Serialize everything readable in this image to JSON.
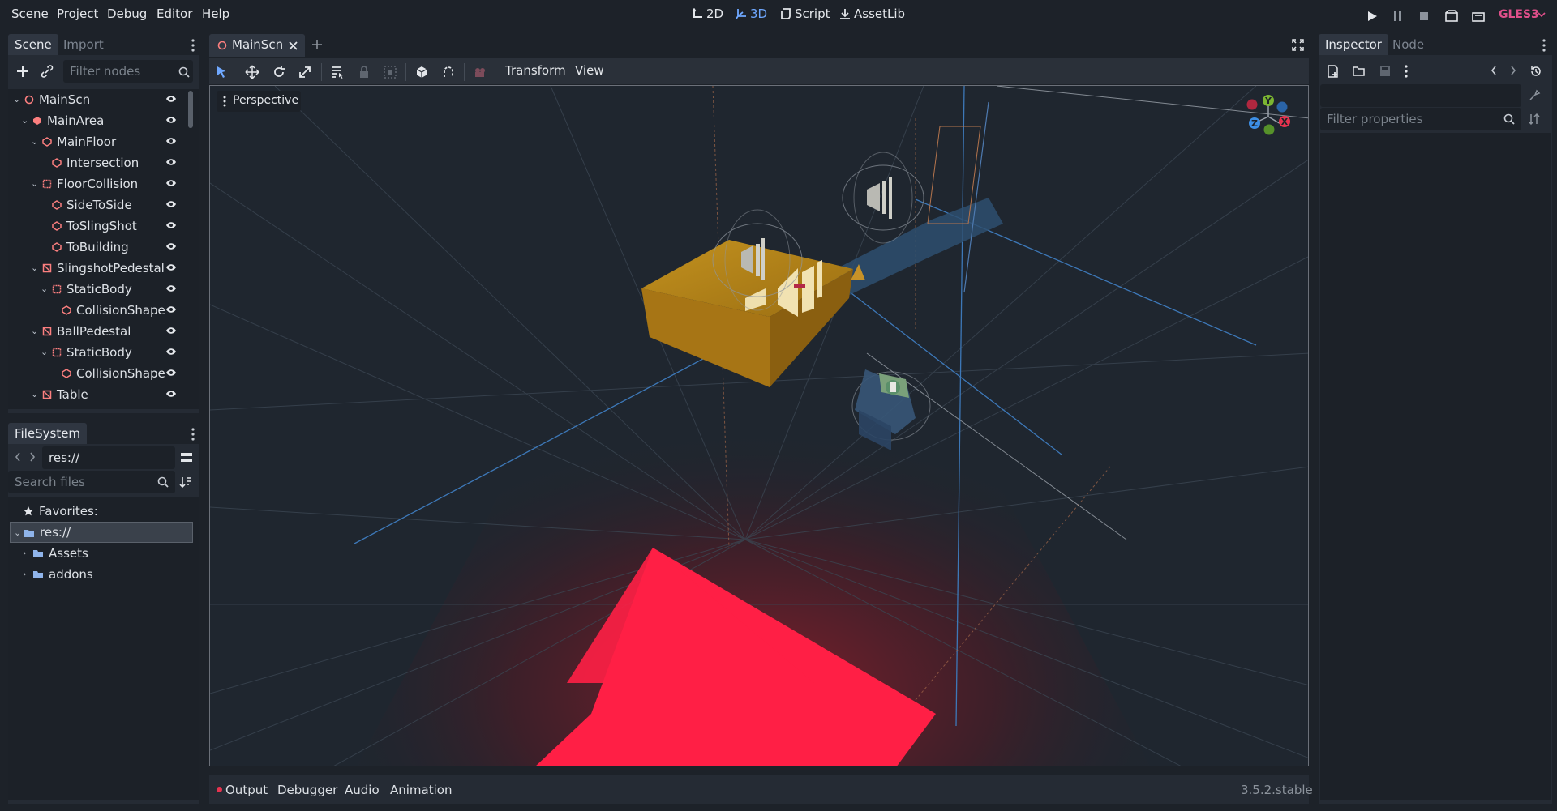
{
  "menu": {
    "scene": "Scene",
    "project": "Project",
    "debug": "Debug",
    "editor": "Editor",
    "help": "Help"
  },
  "workspaces": {
    "twod": "2D",
    "threed": "3D",
    "script": "Script",
    "assetlib": "AssetLib"
  },
  "renderer": "GLES3",
  "scene_dock": {
    "tabs": {
      "scene": "Scene",
      "import": "Import"
    },
    "filter_placeholder": "Filter nodes",
    "tree": [
      {
        "label": "MainScn"
      },
      {
        "label": "MainArea"
      },
      {
        "label": "MainFloor"
      },
      {
        "label": "Intersection"
      },
      {
        "label": "FloorCollision"
      },
      {
        "label": "SideToSide"
      },
      {
        "label": "ToSlingShot"
      },
      {
        "label": "ToBuilding"
      },
      {
        "label": "SlingshotPedestal"
      },
      {
        "label": "StaticBody"
      },
      {
        "label": "CollisionShape"
      },
      {
        "label": "BallPedestal"
      },
      {
        "label": "StaticBody"
      },
      {
        "label": "CollisionShape"
      },
      {
        "label": "Table"
      }
    ]
  },
  "filesystem": {
    "title": "FileSystem",
    "path": "res://",
    "search_placeholder": "Search files",
    "favorites": "Favorites:",
    "items": [
      {
        "label": "res://"
      },
      {
        "label": "Assets"
      },
      {
        "label": "addons"
      }
    ]
  },
  "editor": {
    "tab": "MainScn",
    "transform": "Transform",
    "view": "View",
    "perspective": "Perspective",
    "gizmo": {
      "y": "Y",
      "x": "X",
      "z": "Z"
    }
  },
  "inspector": {
    "tabs": {
      "inspector": "Inspector",
      "node": "Node"
    },
    "filter_placeholder": "Filter properties"
  },
  "bottom": {
    "output": "Output",
    "debugger": "Debugger",
    "audio": "Audio",
    "animation": "Animation",
    "version": "3.5.2.stable"
  },
  "colors": {
    "accent": "#6fa8ff",
    "node_red": "#fc7f7f",
    "floor": "#ff1f45",
    "renderer": "#e04f8a"
  }
}
